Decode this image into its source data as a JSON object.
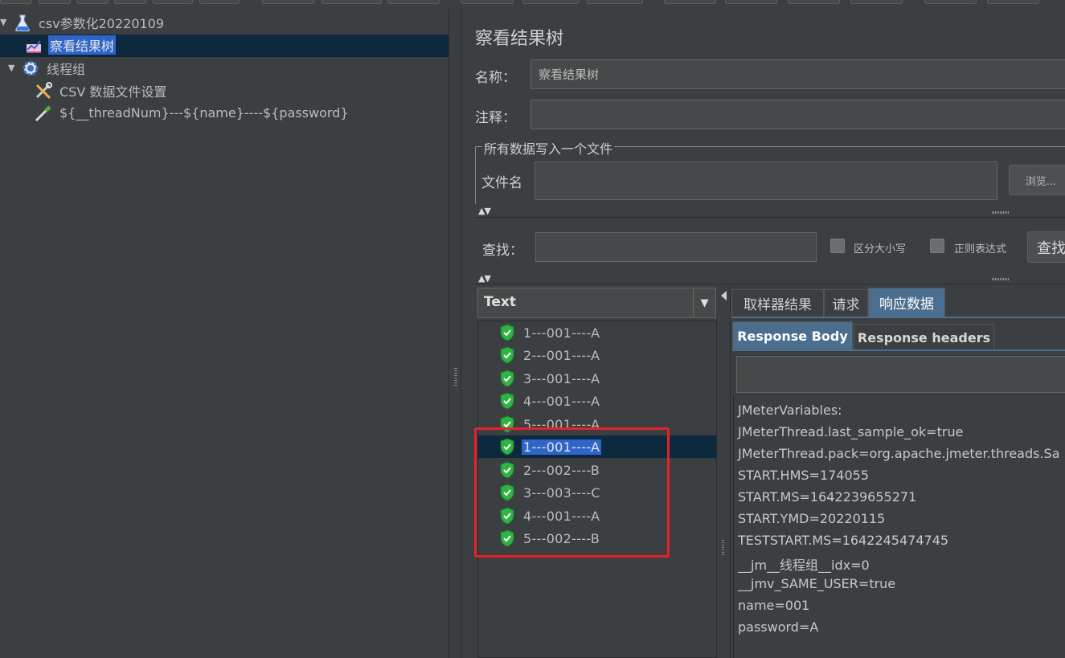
{
  "tree": {
    "root_label": "csv参数化20220109",
    "items": [
      {
        "label": "察看结果树",
        "selected": true,
        "icon": "chart-icon"
      },
      {
        "label": "线程组",
        "icon": "gear-icon"
      },
      {
        "label": "CSV 数据文件设置",
        "icon": "wrench-icon"
      },
      {
        "label": "${__threadNum}---${name}----${password}",
        "icon": "pipette-icon"
      }
    ]
  },
  "panel": {
    "title": "察看结果树",
    "name_label": "名称：",
    "name_value": "察看结果树",
    "comment_label": "注释：",
    "comment_value": "",
    "file_group_legend": "所有数据写入一个文件",
    "filename_label": "文件名",
    "filename_value": "",
    "browse_label": "浏览...",
    "search_label": "查找：",
    "search_value": "",
    "case_sensitive_label": "区分大小写",
    "regex_label": "正则表达式",
    "search_button": "查找"
  },
  "renderer": {
    "selected": "Text"
  },
  "results": [
    {
      "label": "1---001----A",
      "status": "success"
    },
    {
      "label": "2---001----A",
      "status": "success"
    },
    {
      "label": "3---001----A",
      "status": "success"
    },
    {
      "label": "4---001----A",
      "status": "success"
    },
    {
      "label": "5---001----A",
      "status": "success"
    },
    {
      "label": "1---001----A",
      "status": "success",
      "selected": true
    },
    {
      "label": "2---002----B",
      "status": "success"
    },
    {
      "label": "3---003----C",
      "status": "success"
    },
    {
      "label": "4---001----A",
      "status": "success"
    },
    {
      "label": "5---002----B",
      "status": "success"
    }
  ],
  "tabs": {
    "main": [
      "取样器结果",
      "请求",
      "响应数据"
    ],
    "active_main": 2,
    "sub": [
      "Response Body",
      "Response headers"
    ],
    "active_sub": 0
  },
  "response_body": [
    "JMeterVariables:",
    "JMeterThread.last_sample_ok=true",
    "JMeterThread.pack=org.apache.jmeter.threads.Sa",
    "START.HMS=174055",
    "START.MS=1642239655271",
    "START.YMD=20220115",
    "TESTSTART.MS=1642245474745",
    "__jm__线程组__idx=0",
    "__jmv_SAME_USER=true",
    "name=001",
    "password=A"
  ],
  "colors": {
    "background": "#3c3f41",
    "selection": "#2f65ca",
    "active_tab": "#4b6d8e",
    "success_icon": "#2fb344",
    "highlight_box": "#e8202a"
  }
}
